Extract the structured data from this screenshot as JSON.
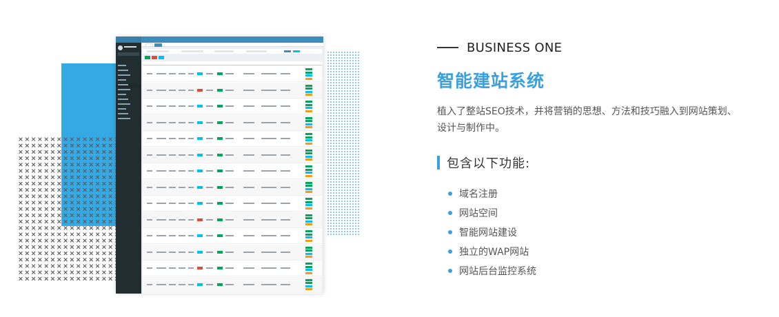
{
  "heading": {
    "eyebrow": "BUSINESS ONE",
    "title": "智能建站系统",
    "description": "植入了整站SEO技术，并将营销的思想、方法和技巧融入到网站策划、设计与制作中。"
  },
  "features": {
    "title": "包含以下功能:",
    "items": [
      {
        "label": "域名注册"
      },
      {
        "label": "网站空间"
      },
      {
        "label": "智能网站建设"
      },
      {
        "label": "独立的WAP网站"
      },
      {
        "label": "网站后台监控系统"
      }
    ]
  },
  "colors": {
    "accent": "#3aa0de",
    "deco_block": "#35a9e4",
    "admin_header": "#3c8dbc",
    "admin_sidebar": "#222d32",
    "tag_green": "#00a65a",
    "tag_red": "#dd4b39",
    "tag_cyan": "#00c0ef",
    "tag_orange": "#f39c12"
  },
  "screenshot": {
    "row_count": 14,
    "status_tags": [
      "cyan",
      "red",
      "cyan",
      "cyan",
      "cyan",
      "cyan",
      "cyan",
      "cyan",
      "cyan",
      "red",
      "cyan",
      "cyan",
      "red",
      "cyan"
    ]
  }
}
